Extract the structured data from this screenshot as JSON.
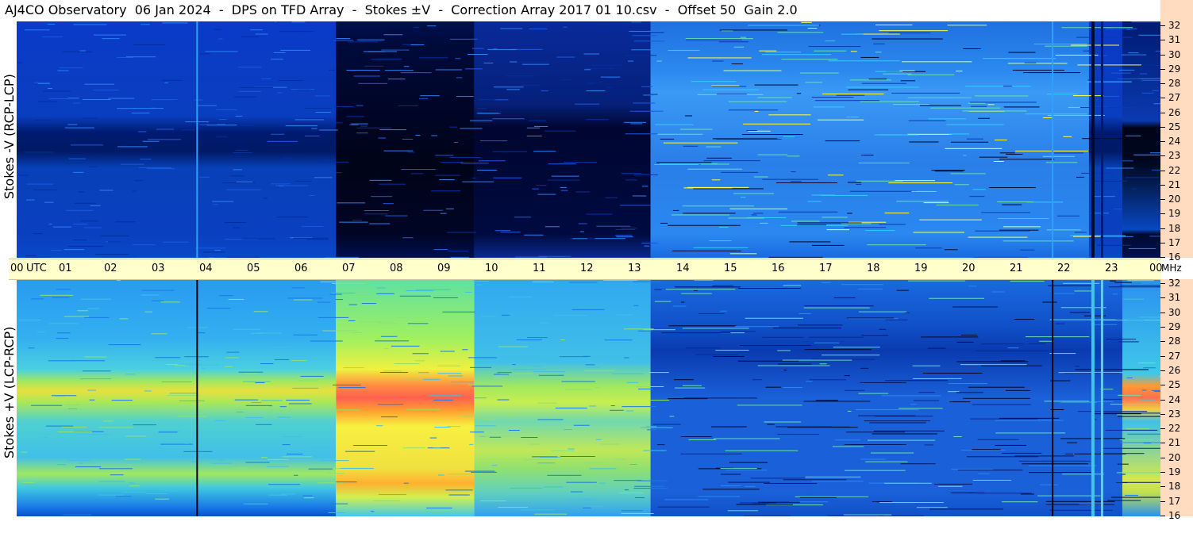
{
  "title": "AJ4CO Observatory  06 Jan 2024  -  DPS on TFD Array  -  Stokes ±V  -  Correction Array 2017 01 10.csv  -  Offset 50  Gain 2.0",
  "chart_data": [
    {
      "type": "heatmap",
      "panel": "top",
      "ylabel": "Stokes -V (RCP-LCP)",
      "y_ticks_mhz": [
        "32",
        "31",
        "30",
        "29",
        "28",
        "27",
        "26",
        "25",
        "24",
        "23",
        "22",
        "21",
        "20",
        "19",
        "18",
        "17",
        "16"
      ],
      "ylim": [
        16,
        32
      ],
      "colormap": [
        "#000010",
        "#001a66",
        "#0040c0",
        "#1a8cff",
        "#33ccff",
        "#66e0b0",
        "#ffff40",
        "#ff9a20",
        "#ff2020"
      ],
      "x_range_utc_hours": [
        0,
        24
      ],
      "description_values": {
        "dark_band_hours": [
          6.7,
          13.3
        ],
        "brighter_region_hours": [
          13.3,
          22.5
        ],
        "dark_band_freq_mhz": [
          23.5,
          25
        ]
      }
    },
    {
      "type": "heatmap",
      "panel": "bottom",
      "ylabel": "Stokes +V (LCP-RCP)",
      "y_ticks_mhz": [
        "32",
        "31",
        "30",
        "29",
        "28",
        "27",
        "26",
        "25",
        "24",
        "23",
        "22",
        "21",
        "20",
        "19",
        "18",
        "17",
        "16"
      ],
      "ylim": [
        16,
        32
      ],
      "colormap": [
        "#000010",
        "#001a66",
        "#0040c0",
        "#1a8cff",
        "#33ccff",
        "#66e0b0",
        "#ffff40",
        "#ff9a20",
        "#ff2020"
      ],
      "x_range_utc_hours": [
        0,
        24
      ],
      "description_values": {
        "bright_band_hours": [
          6.7,
          9.6
        ],
        "bright_band_freq_mhz": [
          24,
          25
        ],
        "warm_region_hours": [
          0,
          13.3
        ]
      }
    }
  ],
  "time_axis": {
    "labels": [
      "00",
      "UTC",
      "01",
      "02",
      "03",
      "04",
      "05",
      "06",
      "07",
      "08",
      "09",
      "10",
      "11",
      "12",
      "13",
      "14",
      "15",
      "16",
      "17",
      "18",
      "19",
      "20",
      "21",
      "22",
      "23",
      "00"
    ],
    "unit": "MHz"
  }
}
